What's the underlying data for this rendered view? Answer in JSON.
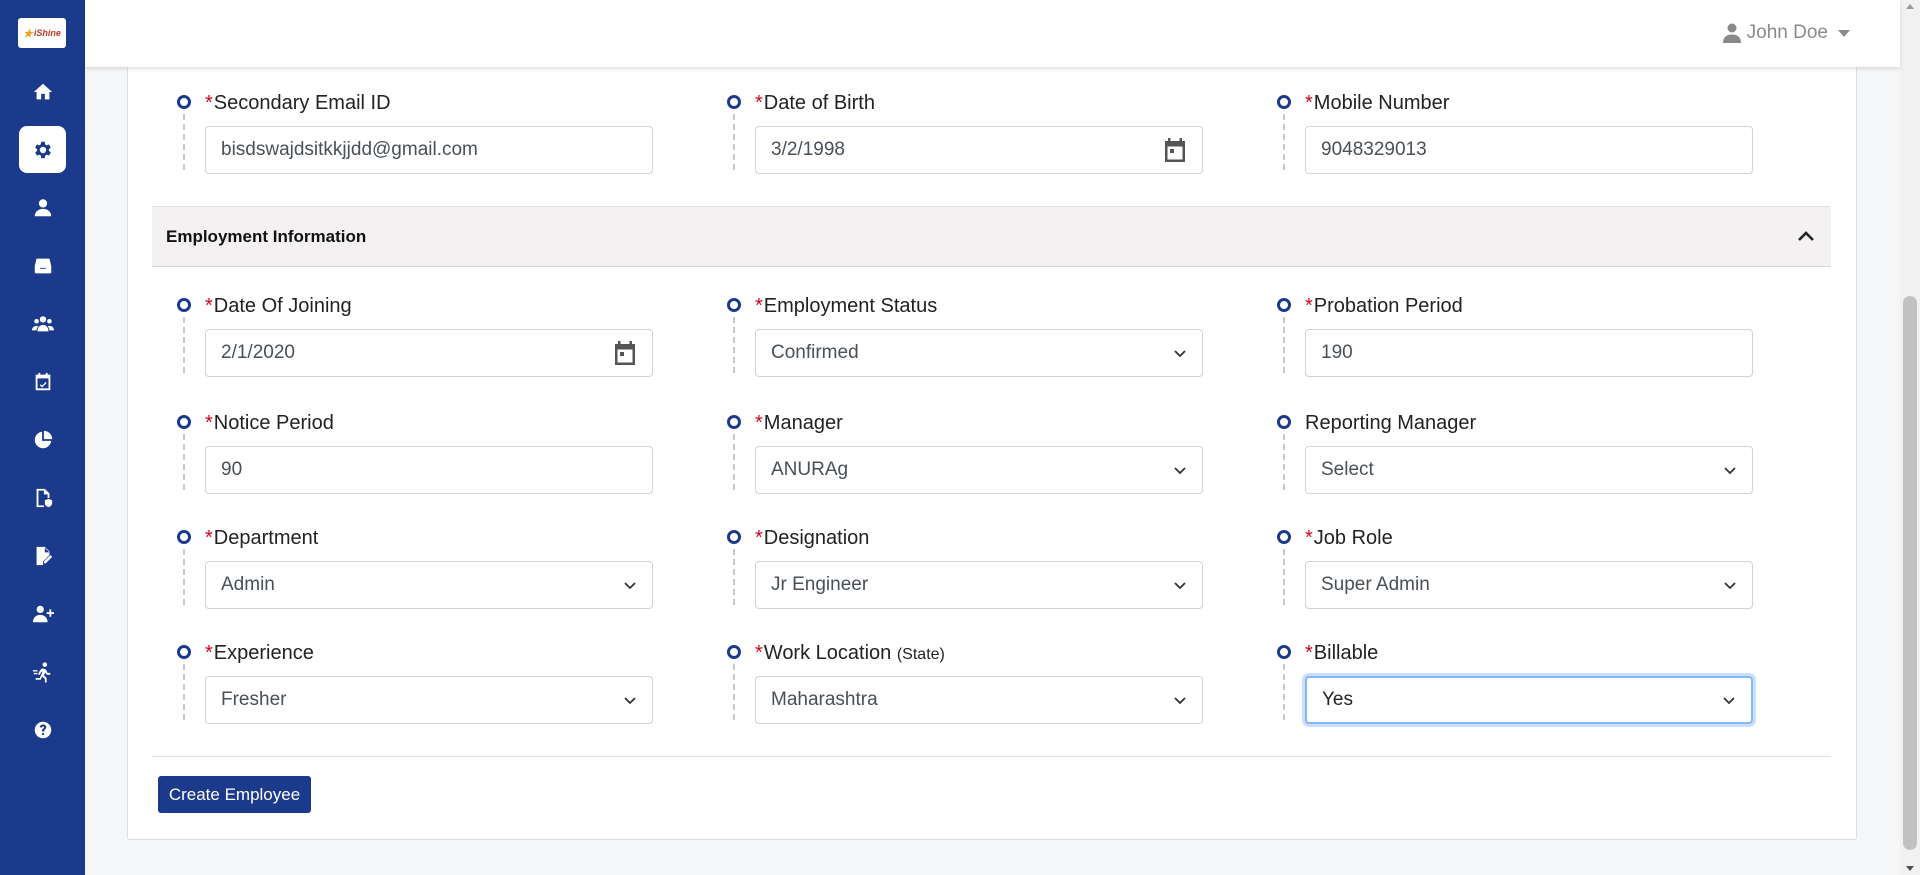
{
  "app": {
    "logo_text": "iShine",
    "brand_color": "#1b3a8c"
  },
  "sidebar": {
    "items": [
      {
        "icon": "home-icon",
        "active": false
      },
      {
        "icon": "gear-icon",
        "active": true
      },
      {
        "icon": "user-icon",
        "active": false
      },
      {
        "icon": "inbox-icon",
        "active": false
      },
      {
        "icon": "users-group-icon",
        "active": false
      },
      {
        "icon": "calendar-check-icon",
        "active": false
      },
      {
        "icon": "pie-chart-icon",
        "active": false
      },
      {
        "icon": "file-shield-icon",
        "active": false
      },
      {
        "icon": "file-signature-icon",
        "active": false
      },
      {
        "icon": "user-plus-icon",
        "active": false
      },
      {
        "icon": "person-running-icon",
        "active": false
      },
      {
        "icon": "help-icon",
        "active": false
      }
    ]
  },
  "header": {
    "user_name": "John Doe"
  },
  "personal": {
    "secondary_email": {
      "label": "Secondary Email ID",
      "required": "*",
      "value": "bisdswajdsitkkjjdd@gmail.com"
    },
    "dob": {
      "label": "Date of Birth",
      "required": "*",
      "value": "3/2/1998"
    },
    "mobile": {
      "label": "Mobile Number",
      "required": "*",
      "value": "9048329013"
    }
  },
  "employment": {
    "title": "Employment Information",
    "date_of_joining": {
      "label": "Date Of Joining",
      "required": "*",
      "value": "2/1/2020"
    },
    "employment_status": {
      "label": "Employment Status",
      "required": "*",
      "value": "Confirmed"
    },
    "probation_period": {
      "label": "Probation Period",
      "required": "*",
      "value": "190"
    },
    "notice_period": {
      "label": "Notice Period",
      "required": "*",
      "value": "90"
    },
    "manager": {
      "label": "Manager",
      "required": "*",
      "value": "ANURAg"
    },
    "reporting_manager": {
      "label": "Reporting Manager",
      "value": "Select"
    },
    "department": {
      "label": "Department",
      "required": "*",
      "value": "Admin"
    },
    "designation": {
      "label": "Designation",
      "required": "*",
      "value": "Jr Engineer"
    },
    "job_role": {
      "label": "Job Role",
      "required": "*",
      "value": "Super Admin"
    },
    "experience": {
      "label": "Experience",
      "required": "*",
      "value": "Fresher"
    },
    "work_location": {
      "label": "Work Location",
      "sub": "(State)",
      "required": "*",
      "value": "Maharashtra"
    },
    "billable": {
      "label": "Billable",
      "required": "*",
      "value": "Yes"
    }
  },
  "actions": {
    "create_label": "Create Employee"
  }
}
